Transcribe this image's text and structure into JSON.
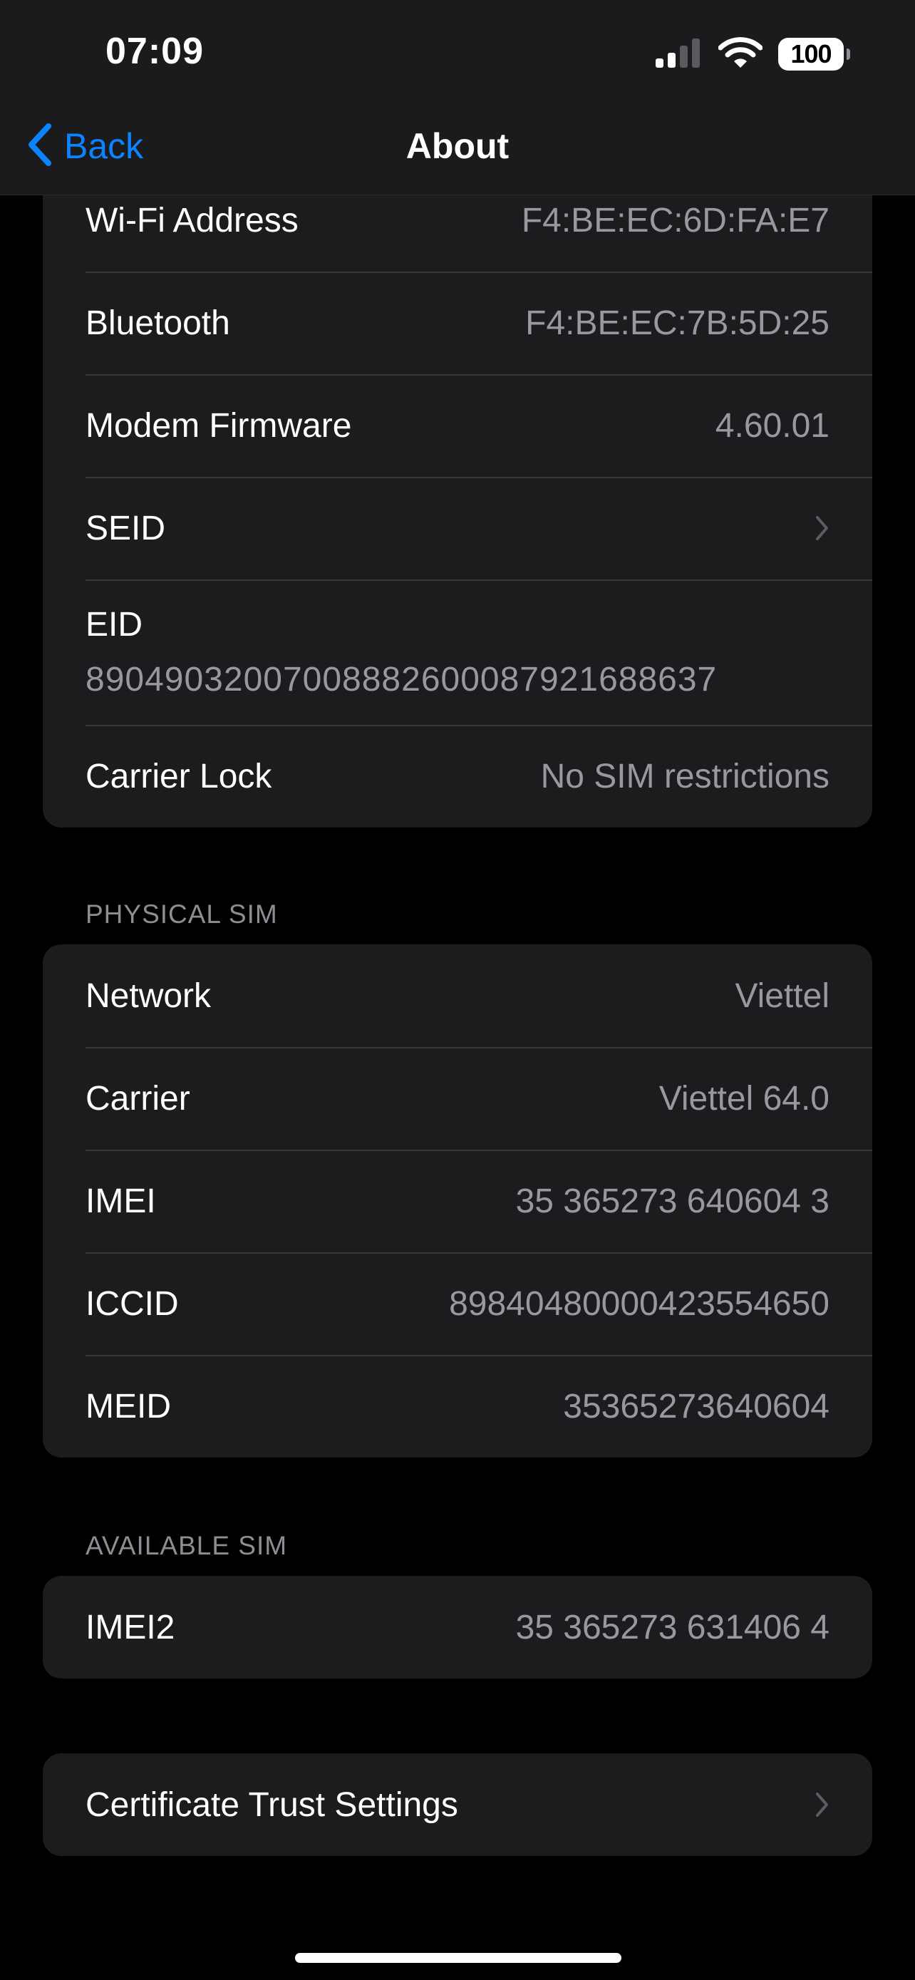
{
  "status_bar": {
    "time": "07:09",
    "battery": "100"
  },
  "nav": {
    "back_label": "Back",
    "title": "About"
  },
  "top_group": {
    "rows": [
      {
        "label": "Wi-Fi Address",
        "value": "F4:BE:EC:6D:FA:E7"
      },
      {
        "label": "Bluetooth",
        "value": "F4:BE:EC:7B:5D:25"
      },
      {
        "label": "Modem Firmware",
        "value": "4.60.01"
      },
      {
        "label": "SEID"
      },
      {
        "label": "EID",
        "value": "89049032007008882600087921688637"
      },
      {
        "label": "Carrier Lock",
        "value": "No SIM restrictions"
      }
    ]
  },
  "physical_sim": {
    "header": "PHYSICAL SIM",
    "rows": [
      {
        "label": "Network",
        "value": "Viettel"
      },
      {
        "label": "Carrier",
        "value": "Viettel 64.0"
      },
      {
        "label": "IMEI",
        "value": "35 365273 640604 3"
      },
      {
        "label": "ICCID",
        "value": "89840480000423554650"
      },
      {
        "label": "MEID",
        "value": "35365273640604"
      }
    ]
  },
  "available_sim": {
    "header": "AVAILABLE SIM",
    "rows": [
      {
        "label": "IMEI2",
        "value": "35 365273 631406 4"
      }
    ]
  },
  "certificate_group": {
    "label": "Certificate Trust Settings"
  },
  "colors": {
    "background": "#000000",
    "cell": "#1c1c1e",
    "accent": "#0a84ff",
    "secondary_text": "#98989f"
  }
}
